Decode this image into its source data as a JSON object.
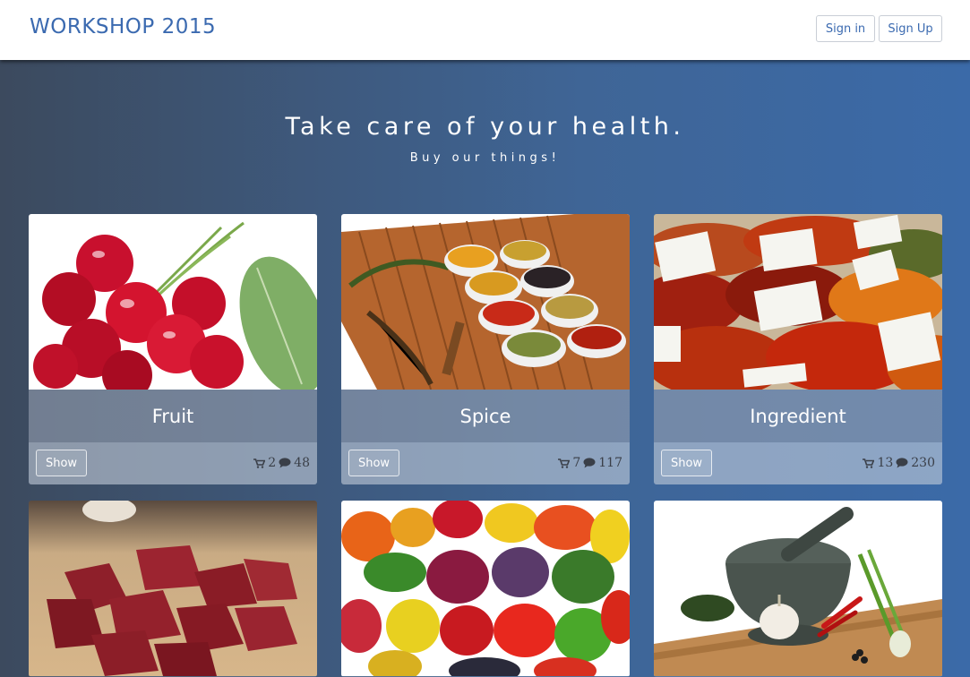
{
  "navbar": {
    "brand": "WORKSHOP 2015",
    "sign_in": "Sign in",
    "sign_up": "Sign Up"
  },
  "hero": {
    "title": "Take care of your health.",
    "subtitle": "Buy our things!"
  },
  "categories": [
    {
      "title": "Fruit",
      "show_label": "Show",
      "cart_count": "2",
      "comment_count": "48",
      "image": "cherries-photo"
    },
    {
      "title": "Spice",
      "show_label": "Show",
      "cart_count": "7",
      "comment_count": "117",
      "image": "spice-bowls-photo"
    },
    {
      "title": "Ingredient",
      "show_label": "Show",
      "cart_count": "13",
      "comment_count": "230",
      "image": "market-spices-photo"
    },
    {
      "image": "raw-beef-cubes-photo"
    },
    {
      "image": "vegetables-fruits-photo"
    },
    {
      "image": "mortar-garlic-photo"
    }
  ],
  "icons": {
    "cart": "cart-icon",
    "comment": "comment-icon"
  },
  "colors": {
    "brand": "#3b6ab0",
    "background_start": "#3c4a5e",
    "background_end": "#3b6aa8"
  }
}
